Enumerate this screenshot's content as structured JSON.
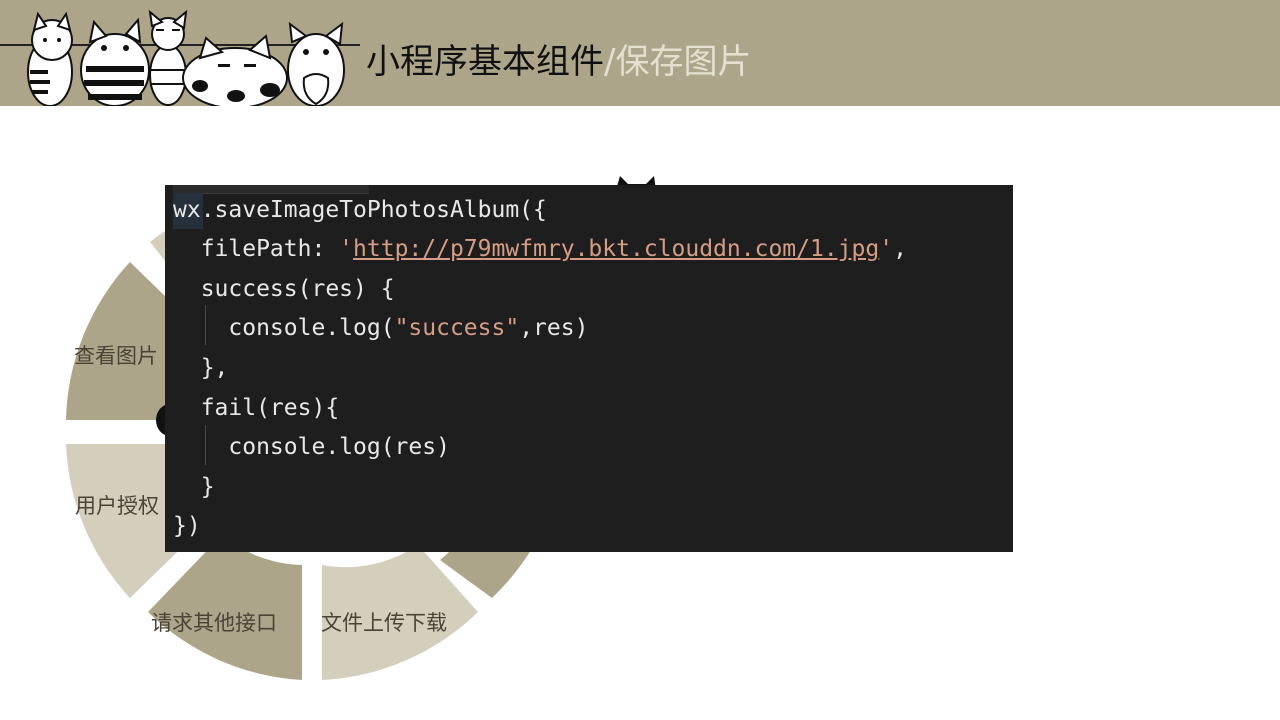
{
  "header": {
    "title_main": "小程序基本组件",
    "title_sep": "/",
    "title_sub": "保存图片"
  },
  "ring": {
    "segments": [
      {
        "label": "查看图片"
      },
      {
        "label": "用户授权"
      },
      {
        "label": "请求其他接口"
      },
      {
        "label": "文件上传下载"
      }
    ],
    "colors": {
      "dark": "#ada58a",
      "light": "#d4cfbd"
    }
  },
  "code": {
    "line1": "wx.saveImageToPhotosAlbum({",
    "line2_key": "  filePath: ",
    "line2_q1": "'",
    "line2_url": "http://p79mwfmry.bkt.clouddn.com/1.jpg",
    "line2_q2": "'",
    "line2_end": ",",
    "line3": "  success(res) {",
    "line4_pre": "    console.log(",
    "line4_str": "\"success\"",
    "line4_post": ",res)",
    "line5": "  },",
    "line6": "  fail(res){",
    "line7": "    console.log(res)",
    "line8": "  }",
    "line9": "})"
  },
  "colors": {
    "header_bg": "#ada58a",
    "code_bg": "#1e1e1e",
    "string": "#d69d85"
  }
}
